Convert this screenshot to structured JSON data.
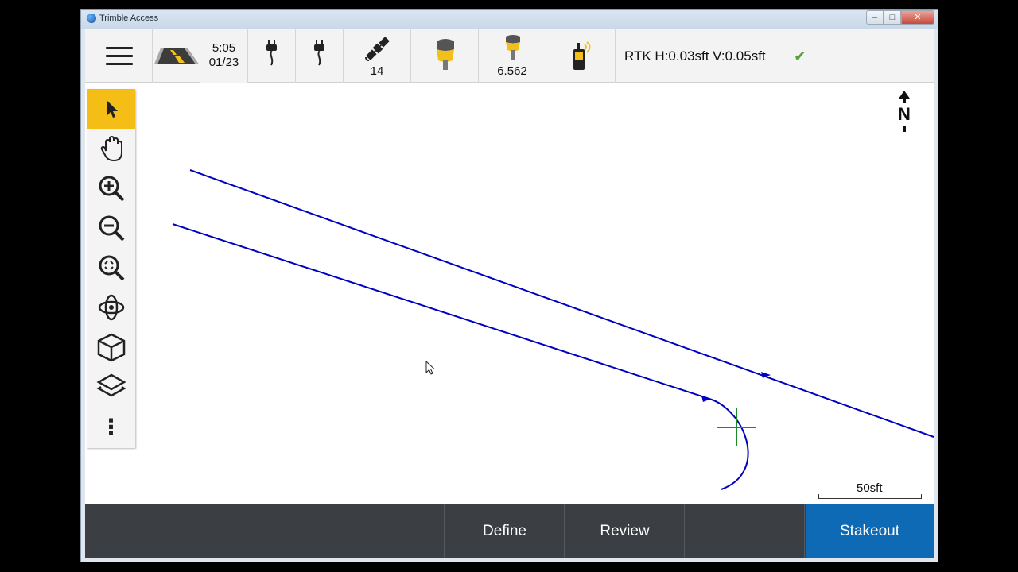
{
  "window": {
    "title": "Trimble Access",
    "minimize": "–",
    "maximize": "□",
    "close": "✕"
  },
  "status": {
    "time": "5:05",
    "date": "01/23",
    "satellites": "14",
    "antenna_height": "6.562",
    "rtk": "RTK H:0.03sft V:0.05sft",
    "rtk_ok": "✔"
  },
  "map": {
    "north_label": "N",
    "scale": "50sft"
  },
  "toolbar": {
    "items": [
      "select",
      "pan",
      "zoom-in",
      "zoom-out",
      "zoom-extents",
      "orbit",
      "predefined-view",
      "layers",
      "more"
    ],
    "more_label": "⋮"
  },
  "bottom": {
    "buttons": [
      "",
      "",
      "",
      "Define",
      "Review",
      "",
      "Stakeout"
    ]
  },
  "colors": {
    "accent": "#f5be16",
    "primary_button": "#0f6ab5",
    "line": "#0000c0",
    "crosshair": "#1a8a2a",
    "bottom_bar": "#3b3e43"
  }
}
